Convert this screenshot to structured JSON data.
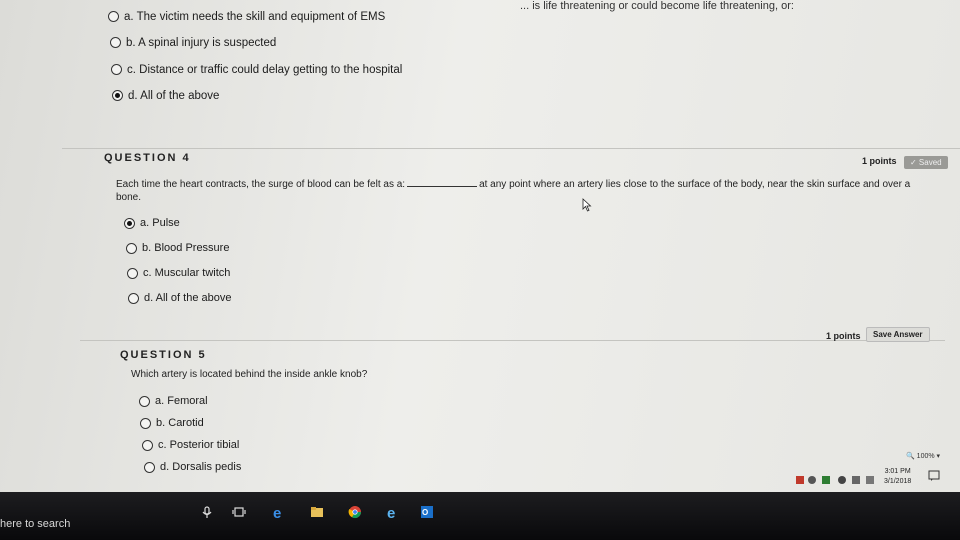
{
  "top_header_text": "... is life threatening or could become life threatening, or:",
  "question3": {
    "options": [
      {
        "letter": "a.",
        "text": "The victim needs the skill and equipment of EMS",
        "selected": false
      },
      {
        "letter": "b.",
        "text": "A spinal injury is suspected",
        "selected": false
      },
      {
        "letter": "c.",
        "text": "Distance or traffic could delay getting to the hospital",
        "selected": false
      },
      {
        "letter": "d.",
        "text": "All of the above",
        "selected": true
      }
    ]
  },
  "question4": {
    "title": "QUESTION 4",
    "points": "1 points",
    "status": "✓ Saved",
    "text_before": "Each time the heart contracts, the surge of blood can be felt as a:",
    "text_after": "at any point where an artery lies close to the surface of the body, near the skin surface and over a",
    "text_end": "bone.",
    "options": [
      {
        "letter": "a.",
        "text": "Pulse",
        "selected": true
      },
      {
        "letter": "b.",
        "text": "Blood Pressure",
        "selected": false
      },
      {
        "letter": "c.",
        "text": "Muscular twitch",
        "selected": false
      },
      {
        "letter": "d.",
        "text": "All of the above",
        "selected": false
      }
    ]
  },
  "question5": {
    "title": "QUESTION 5",
    "points": "1 points",
    "status": "Save Answer",
    "text": "Which artery is located behind the inside ankle knob?",
    "options": [
      {
        "letter": "a.",
        "text": "Femoral",
        "selected": false
      },
      {
        "letter": "b.",
        "text": "Carotid",
        "selected": false
      },
      {
        "letter": "c.",
        "text": "Posterior tibial",
        "selected": false
      },
      {
        "letter": "d.",
        "text": "Dorsalis pedis",
        "selected": false
      }
    ]
  },
  "zoom": "100%",
  "taskbar": {
    "search_text": "here to search",
    "clock_time": "3:01 PM",
    "clock_date": "3/1/2018"
  }
}
